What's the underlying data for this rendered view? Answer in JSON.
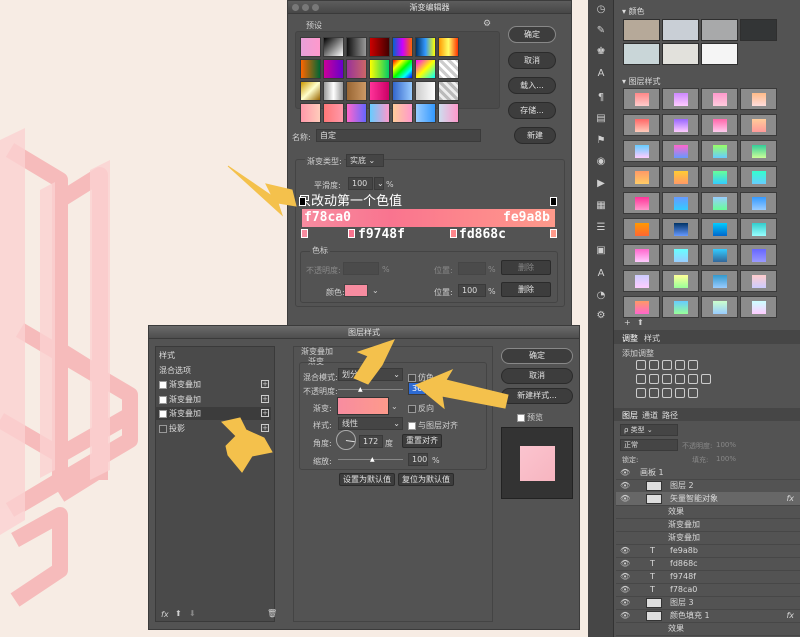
{
  "gradient_editor": {
    "title": "渐变编辑器",
    "presets_label": "预设",
    "ok": "确定",
    "cancel": "取消",
    "load": "载入...",
    "save": "存储...",
    "name_label": "名称:",
    "name_value": "自定",
    "new": "新建",
    "type_label": "渐变类型:",
    "type_value": "实底",
    "smooth_label": "平滑度:",
    "smooth_value": "100",
    "smooth_unit": "%",
    "stops_label": "色标",
    "opacity_label": "不透明度:",
    "opacity_unit": "%",
    "location_label": "位置:",
    "location_unit": "%",
    "delete": "删除",
    "color_label": "颜色:",
    "color_location": "100",
    "annotation": "只改动第一个色值",
    "hex_1": "f78ca0",
    "hex_2": "fe9a8b",
    "hex_3": "f9748f",
    "hex_4": "fd868c",
    "colors": {
      "c1": "#f78ca0",
      "c2": "#f9748f",
      "c3": "#fd868c",
      "c4": "#fe9a8b"
    }
  },
  "layer_style": {
    "title": "图层样式",
    "sidebar": [
      "样式",
      "混合选项",
      "渐变叠加",
      "渐变叠加",
      "渐变叠加",
      "投影"
    ],
    "section_title": "渐变叠加",
    "subsection": "渐变",
    "blend_label": "混合模式:",
    "blend_value": "划分",
    "dither": "仿色",
    "opacity_label": "不透明度:",
    "opacity_value": "36",
    "gradient_label": "渐变:",
    "reverse": "反向",
    "style_label": "样式:",
    "style_value": "线性",
    "align": "与图层对齐",
    "angle_label": "角度:",
    "angle_value": "172",
    "angle_unit": "度",
    "reset_align": "重置对齐",
    "scale_label": "缩放:",
    "scale_value": "100",
    "scale_unit": "%",
    "set_default": "设置为默认值",
    "reset_default": "复位为默认值",
    "ok": "确定",
    "cancel": "取消",
    "new_style": "新建样式...",
    "preview": "预览",
    "footer_fx": "fx"
  },
  "swatches_panel": {
    "tab": "颜色",
    "colors": [
      "#b6a999",
      "#c9cfd6",
      "#a8a9aa",
      "#333536",
      "#c9d6d8",
      "#e2e1dc",
      "#f5f5f5"
    ]
  },
  "styles_panel": {
    "tab": "图层样式"
  },
  "adjust_panel": {
    "tabs": [
      "调整",
      "样式"
    ],
    "add_label": "添加调整"
  },
  "layers_panel": {
    "tabs": [
      "图层",
      "通道",
      "路径"
    ],
    "filter": "类型",
    "blend": "正常",
    "opacity_label": "不透明度:",
    "opacity_value": "100%",
    "lock_label": "锁定:",
    "fill_label": "填充:",
    "fill_value": "100%",
    "rows": [
      {
        "name": "画板 1",
        "kind": "group"
      },
      {
        "name": "图层 2",
        "kind": "layer"
      },
      {
        "name": "矢量智能对象",
        "kind": "smart",
        "fx": "fx"
      },
      {
        "name": "效果",
        "kind": "effect"
      },
      {
        "name": "渐变叠加",
        "kind": "effect"
      },
      {
        "name": "渐变叠加",
        "kind": "effect"
      },
      {
        "name": "fe9a8b",
        "kind": "text"
      },
      {
        "name": "fd868c",
        "kind": "text"
      },
      {
        "name": "f9748f",
        "kind": "text"
      },
      {
        "name": "f78ca0",
        "kind": "text"
      },
      {
        "name": "图层 3",
        "kind": "layer"
      },
      {
        "name": "颜色填充 1",
        "kind": "fill",
        "fx": "fx"
      },
      {
        "name": "效果",
        "kind": "effect"
      }
    ]
  }
}
